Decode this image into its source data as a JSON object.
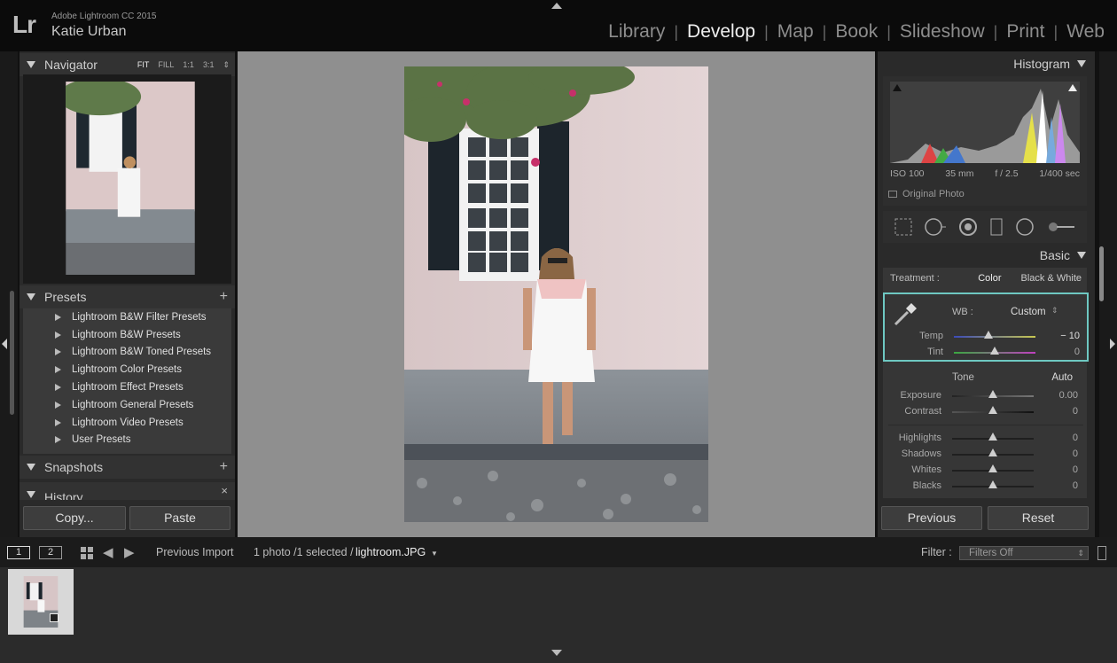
{
  "app": {
    "logo": "Lr",
    "product": "Adobe Lightroom CC 2015",
    "user": "Katie Urban"
  },
  "modules": [
    {
      "label": "Library",
      "active": false
    },
    {
      "label": "Develop",
      "active": true
    },
    {
      "label": "Map",
      "active": false
    },
    {
      "label": "Book",
      "active": false
    },
    {
      "label": "Slideshow",
      "active": false
    },
    {
      "label": "Print",
      "active": false
    },
    {
      "label": "Web",
      "active": false
    }
  ],
  "navigator": {
    "title": "Navigator",
    "zoom": [
      "FIT",
      "FILL",
      "1:1",
      "3:1"
    ]
  },
  "presets": {
    "title": "Presets",
    "items": [
      "Lightroom B&W Filter Presets",
      "Lightroom B&W Presets",
      "Lightroom B&W Toned Presets",
      "Lightroom Color Presets",
      "Lightroom Effect Presets",
      "Lightroom General Presets",
      "Lightroom Video Presets",
      "User Presets"
    ]
  },
  "snapshots": {
    "title": "Snapshots"
  },
  "history": {
    "title": "History"
  },
  "left_buttons": {
    "copy": "Copy...",
    "paste": "Paste"
  },
  "histogram": {
    "title": "Histogram",
    "iso": "ISO 100",
    "focal": "35 mm",
    "aperture": "f / 2.5",
    "shutter": "1/400 sec",
    "original_photo": "Original Photo"
  },
  "basic": {
    "title": "Basic",
    "treatment_label": "Treatment :",
    "treatment_color": "Color",
    "treatment_bw": "Black & White",
    "wb_label": "WB :",
    "wb_value": "Custom",
    "temp": {
      "label": "Temp",
      "value": "− 10"
    },
    "tint": {
      "label": "Tint",
      "value": "0"
    },
    "tone_label": "Tone",
    "auto_label": "Auto",
    "exposure": {
      "label": "Exposure",
      "value": "0.00"
    },
    "contrast": {
      "label": "Contrast",
      "value": "0"
    },
    "highlights": {
      "label": "Highlights",
      "value": "0"
    },
    "shadows": {
      "label": "Shadows",
      "value": "0"
    },
    "whites": {
      "label": "Whites",
      "value": "0"
    },
    "blacks": {
      "label": "Blacks",
      "value": "0"
    }
  },
  "right_buttons": {
    "previous": "Previous",
    "reset": "Reset"
  },
  "bottombar": {
    "view1": "1",
    "view2": "2",
    "source": "Previous Import",
    "count": "1 photo /1 selected /",
    "filename": "lightroom.JPG",
    "filter_label": "Filter :",
    "filter_value": "Filters Off"
  }
}
